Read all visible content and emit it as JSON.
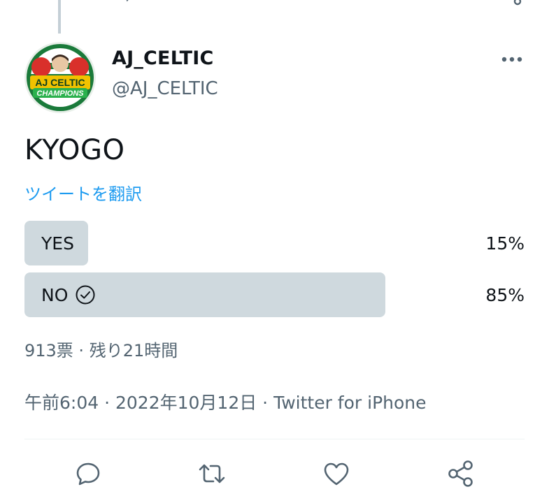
{
  "tweet": {
    "author": {
      "display_name": "AJ_CELTIC",
      "handle": "@AJ_CELTIC",
      "avatar_text_top": "AJ CELTIC",
      "avatar_text_bottom": "CHAMPIONS"
    },
    "text": "KYOGO",
    "translate_label": "ツイートを翻訳",
    "poll": {
      "options": [
        {
          "label": "YES",
          "percent": "15%",
          "fraction": 0.15,
          "selected": false
        },
        {
          "label": "NO",
          "percent": "85%",
          "fraction": 0.85,
          "selected": true
        }
      ],
      "meta": "913票 · 残り21時間"
    },
    "timestamp": "午前6:04 · 2022年10月12日 · Twitter for iPhone"
  },
  "actions": [
    {
      "name": "reply",
      "icon": "reply-icon"
    },
    {
      "name": "retweet",
      "icon": "retweet-icon"
    },
    {
      "name": "like",
      "icon": "heart-icon"
    },
    {
      "name": "share",
      "icon": "share-icon"
    }
  ],
  "colors": {
    "link": "#1d9bf0",
    "secondary_text": "#536471",
    "poll_fill": "#cfd9de"
  }
}
